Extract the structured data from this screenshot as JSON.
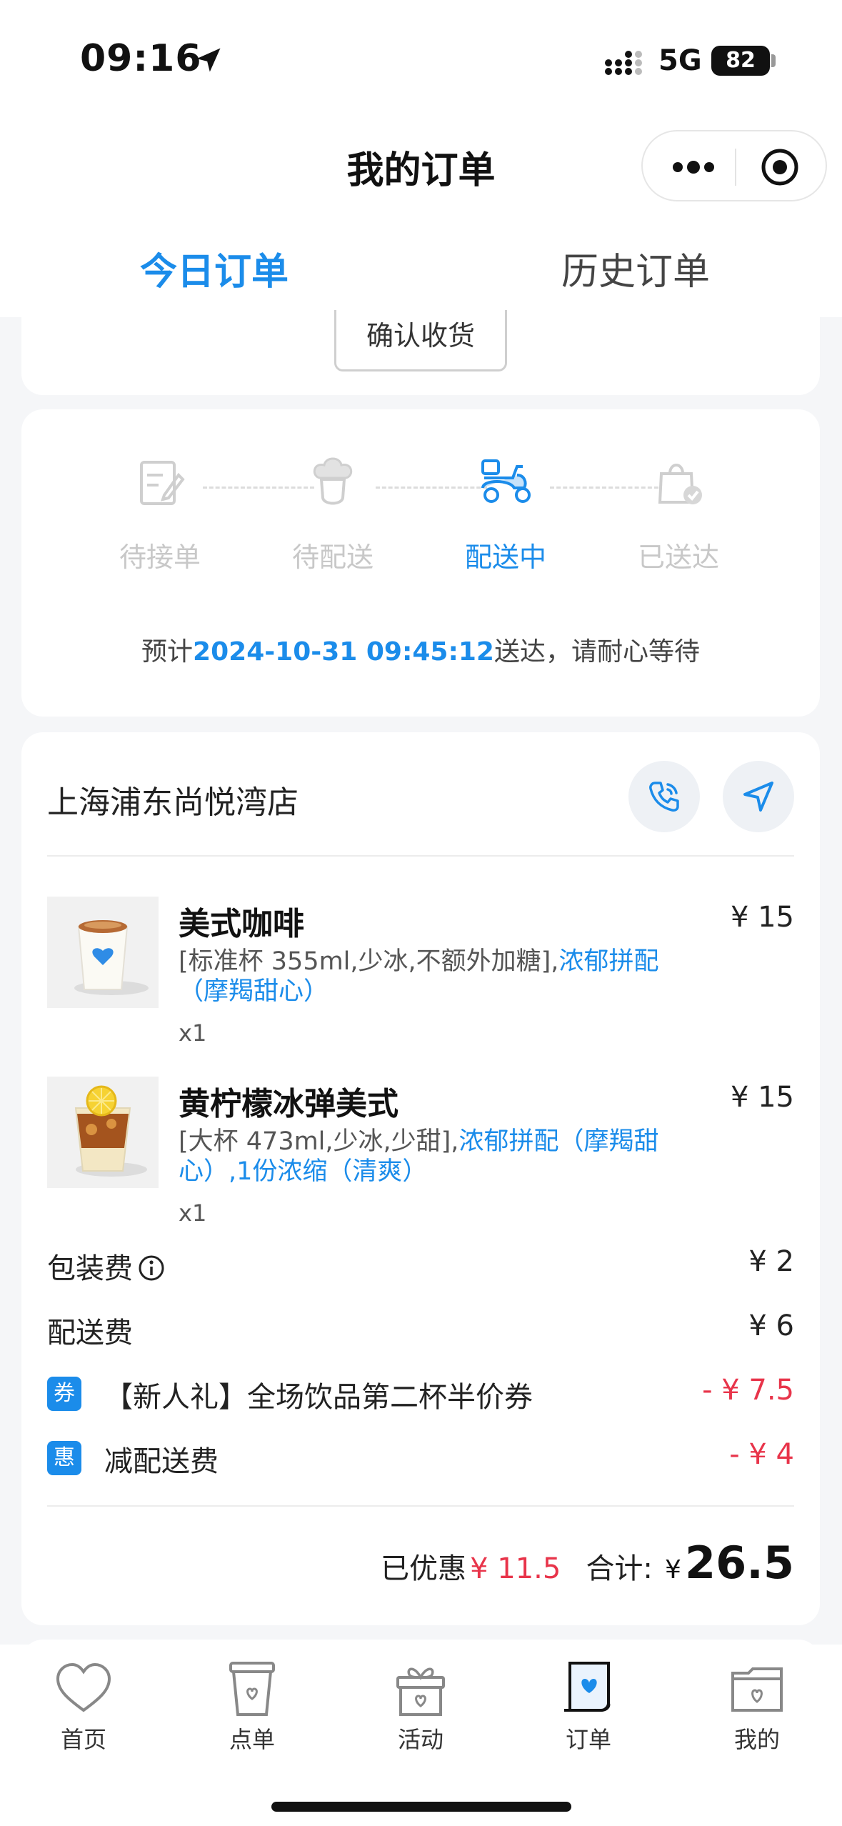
{
  "status_bar": {
    "time": "09:16",
    "network": "5G",
    "battery": "82"
  },
  "header": {
    "title": "我的订单"
  },
  "tabs": [
    {
      "label": "今日订单",
      "active": true
    },
    {
      "label": "历史订单",
      "active": false
    }
  ],
  "top_card": {
    "confirm_button": "确认收货"
  },
  "progress": {
    "steps": [
      {
        "label": "待接单",
        "icon": "form-icon",
        "active": false
      },
      {
        "label": "待配送",
        "icon": "chef-icon",
        "active": false
      },
      {
        "label": "配送中",
        "icon": "scooter-icon",
        "active": true
      },
      {
        "label": "已送达",
        "icon": "bag-check-icon",
        "active": false
      }
    ],
    "eta_prefix": "预计",
    "eta_time": "2024-10-31 09:45:12",
    "eta_suffix": "送达，请耐心等待"
  },
  "order": {
    "store_name": "上海浦东尚悦湾店",
    "items": [
      {
        "name": "美式咖啡",
        "price": "¥ 15",
        "options_plain": "[标准杯 355ml,少冰,不额外加糖],",
        "options_highlight": "浓郁拼配（摩羯甜心）",
        "qty": "x1"
      },
      {
        "name": "黄柠檬冰弹美式",
        "price": "¥ 15",
        "options_plain": "[大杯 473ml,少冰,少甜],",
        "options_highlight": "浓郁拼配（摩羯甜心）,1份浓缩（清爽）",
        "qty": "x1"
      }
    ],
    "fees": {
      "packaging_label": "包装费",
      "packaging_value": "¥ 2",
      "delivery_label": "配送费",
      "delivery_value": "¥ 6"
    },
    "discounts": [
      {
        "tag": "券",
        "label": "【新人礼】全场饮品第二杯半价券",
        "value": "- ¥ 7.5"
      },
      {
        "tag": "惠",
        "label": "减配送费",
        "value": "- ¥ 4"
      }
    ],
    "summary": {
      "discount_label": "已优惠",
      "discount_value": "¥ 11.5",
      "total_label": "合计:",
      "currency": "¥",
      "total_value": "26.5"
    }
  },
  "tabbar": [
    {
      "label": "首页",
      "icon": "heart-icon",
      "active": false
    },
    {
      "label": "点单",
      "icon": "cup-icon",
      "active": false
    },
    {
      "label": "活动",
      "icon": "gift-icon",
      "active": false
    },
    {
      "label": "订单",
      "icon": "order-icon",
      "active": true
    },
    {
      "label": "我的",
      "icon": "folder-icon",
      "active": false
    }
  ],
  "colors": {
    "accent": "#1b8cea",
    "price_red": "#e8344a",
    "background": "#f5f6f8"
  }
}
